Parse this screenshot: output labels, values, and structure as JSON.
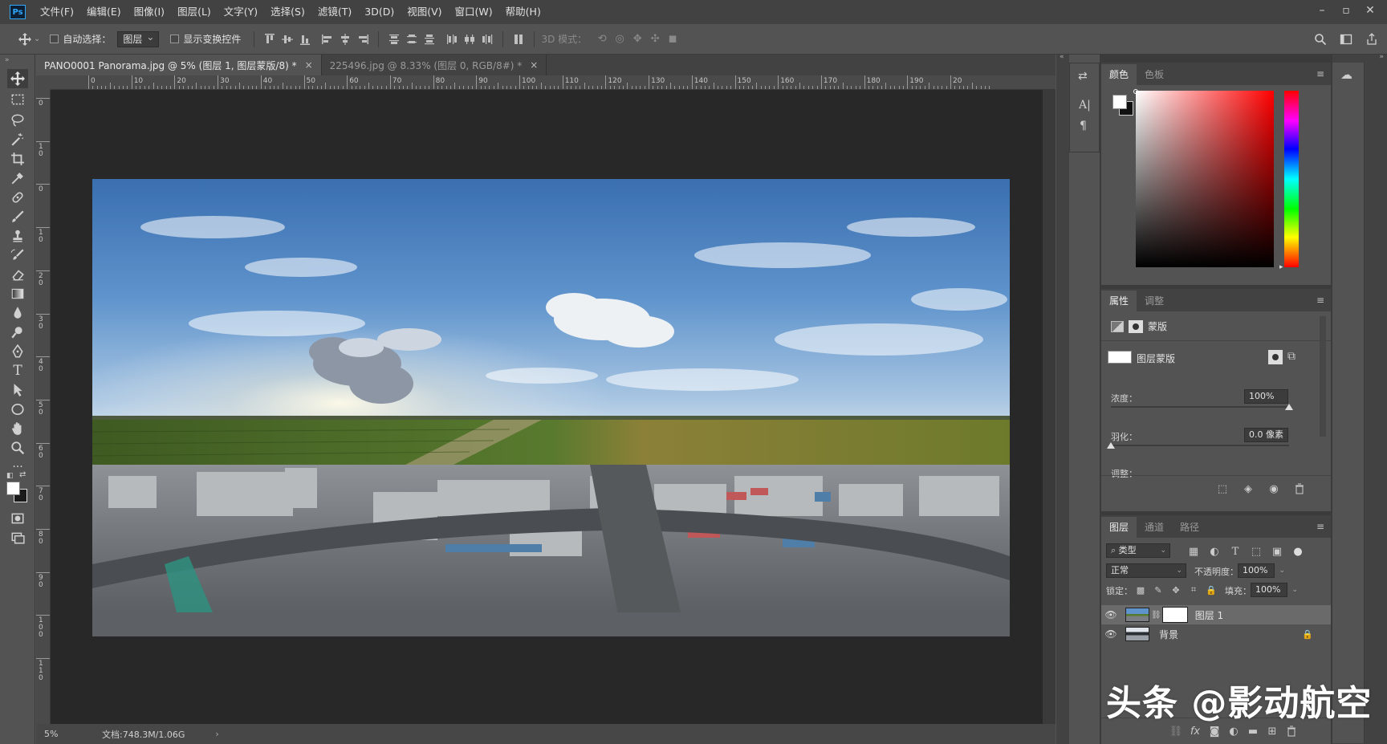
{
  "app": {
    "logo": "Ps"
  },
  "menu": [
    "文件(F)",
    "编辑(E)",
    "图像(I)",
    "图层(L)",
    "文字(Y)",
    "选择(S)",
    "滤镜(T)",
    "3D(D)",
    "视图(V)",
    "窗口(W)",
    "帮助(H)"
  ],
  "options": {
    "auto_select_label": "自动选择：",
    "auto_select_value": "图层",
    "show_transform_label": "显示变换控件",
    "mode_3d_label": "3D 模式："
  },
  "tabs": [
    {
      "label": "PANO0001 Panorama.jpg @ 5% (图层 1, 图层蒙版/8) *",
      "close": "×"
    },
    {
      "label": "225496.jpg @ 8.33% (图层 0, RGB/8#) *",
      "close": "×"
    }
  ],
  "ruler": {
    "top_labels": [
      "0",
      "10",
      "20",
      "30",
      "40",
      "50",
      "60",
      "70",
      "80",
      "90",
      "100",
      "110",
      "120",
      "130",
      "140",
      "150",
      "160",
      "170",
      "180",
      "190",
      "20"
    ],
    "left_labels": [
      "0",
      "1\n0",
      "0",
      "1\n0",
      "2\n0",
      "3\n0",
      "4\n0",
      "5\n0",
      "6\n0",
      "7\n0",
      "8\n0",
      "9\n0",
      "1\n0\n0",
      "1\n1\n0"
    ]
  },
  "status": {
    "zoom": "5%",
    "doc": "文档:748.3M/1.06G",
    "arrow": "›"
  },
  "color_panel": {
    "tabs": [
      "颜色",
      "色板"
    ]
  },
  "properties_panel": {
    "tabs": [
      "属性",
      "调整"
    ],
    "mask_label": "蒙版",
    "layer_mask_label": "图层蒙版",
    "density_label": "浓度：",
    "density_value": "100%",
    "feather_label": "羽化：",
    "feather_value": "0.0 像素",
    "adjust_label": "调整：",
    "density": 1.0,
    "feather": 0.0
  },
  "layers_panel": {
    "tabs": [
      "图层",
      "通道",
      "路径"
    ],
    "filter_label": "类型",
    "blend_mode": "正常",
    "opacity_label": "不透明度：",
    "opacity_value": "100%",
    "lock_label": "锁定：",
    "fill_label": "填充：",
    "fill_value": "100%",
    "layers": [
      {
        "name": "图层 1",
        "selected": true
      },
      {
        "name": "背景",
        "selected": false,
        "locked": true
      }
    ],
    "footer_fx": "fx"
  },
  "watermark": "头条 @影动航空",
  "colors": {
    "accent": "#31a8ff",
    "panel_bg": "#535353",
    "dark_bg": "#424242",
    "canvas_bg": "#282828"
  }
}
